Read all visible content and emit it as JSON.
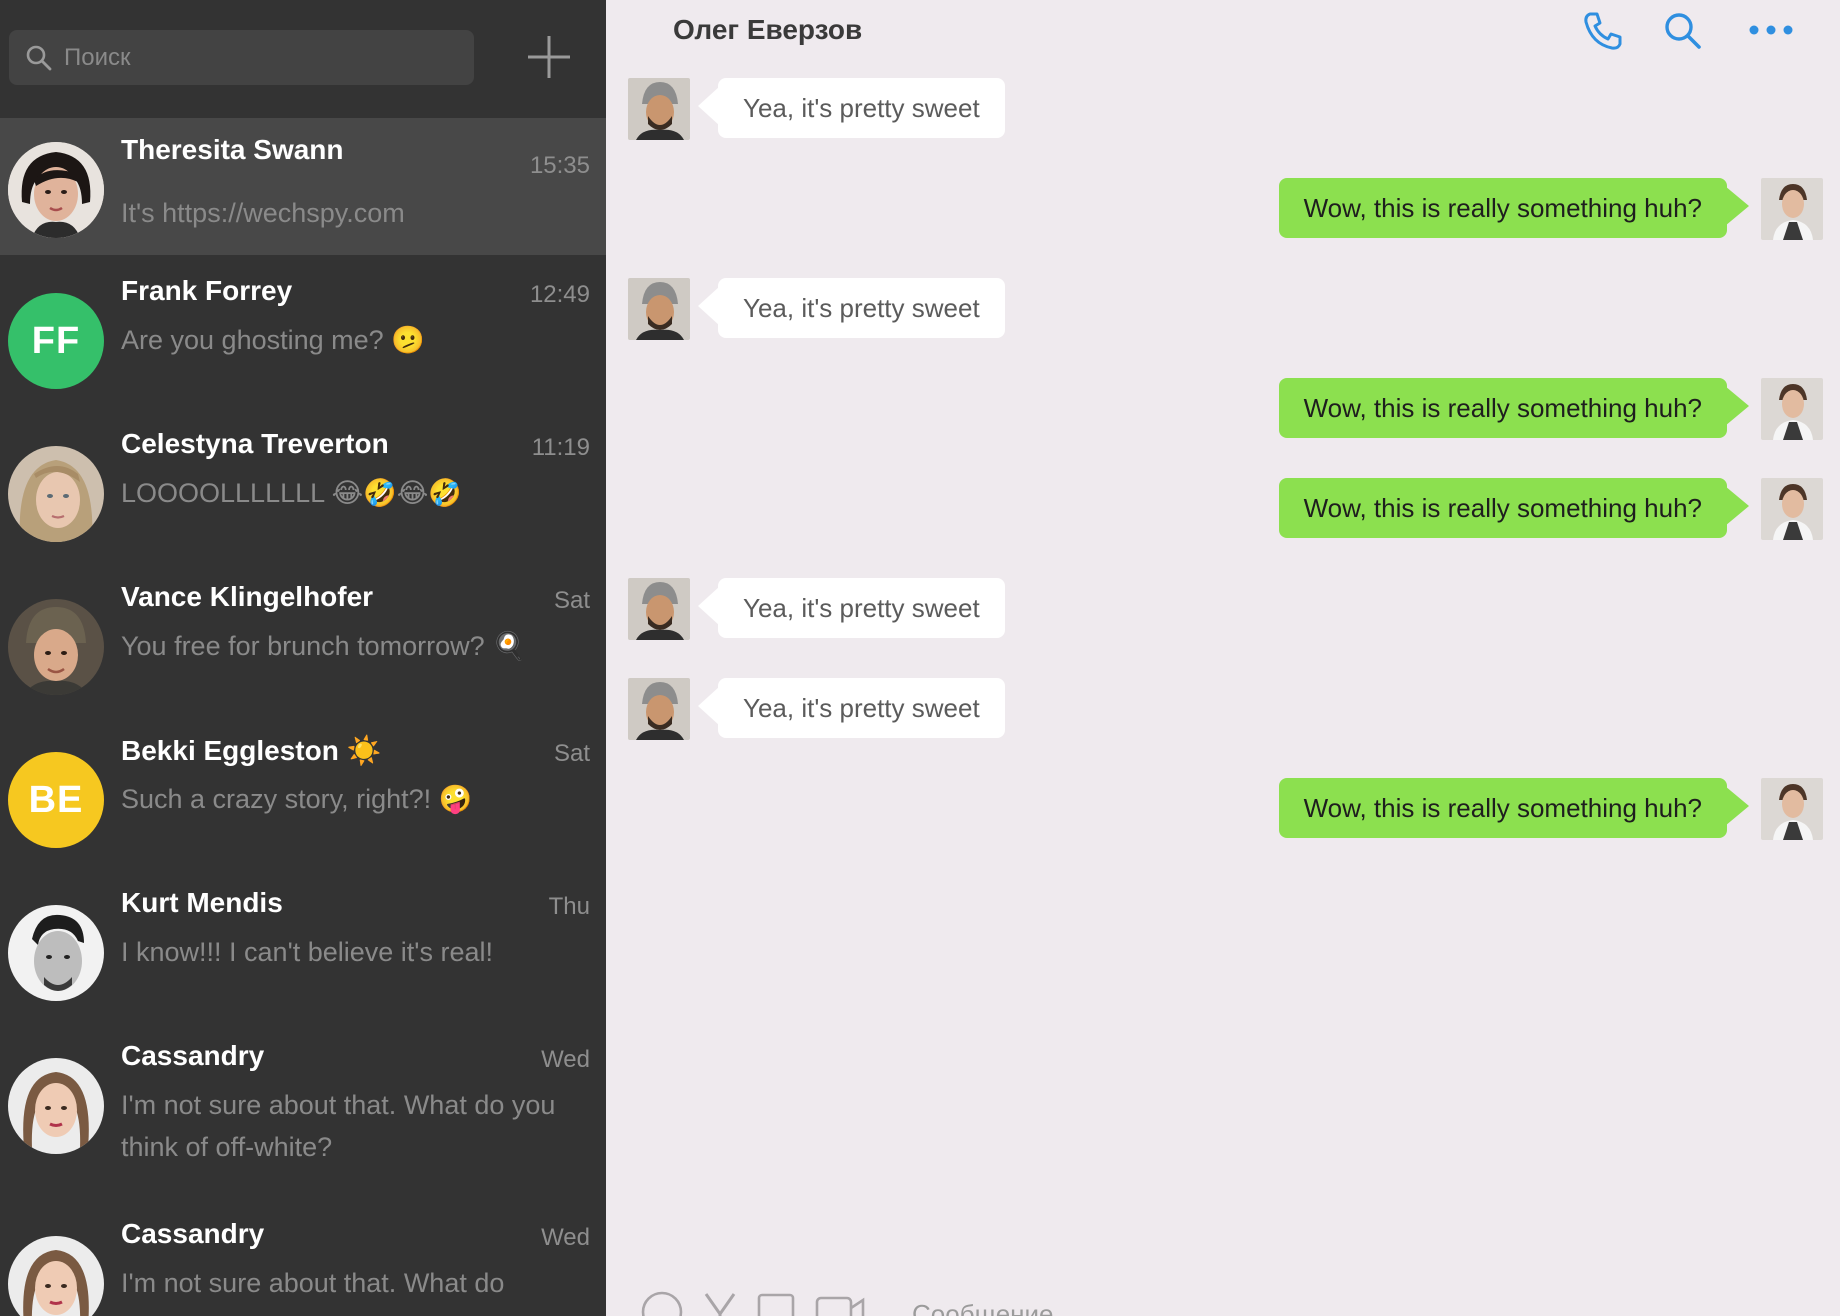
{
  "sidebar": {
    "search": {
      "placeholder": "Поиск",
      "value": ""
    },
    "new_chat_icon": "plus-icon",
    "chats": [
      {
        "name": "Theresita Swann",
        "time": "15:35",
        "preview": "It's https://wechspy.com",
        "avatar": "photo",
        "active": true
      },
      {
        "name": "Frank Forrey",
        "time": "12:49",
        "preview": "Are you ghosting me? 🫤",
        "avatar_initials": "FF",
        "avatar_color": "#35c06a"
      },
      {
        "name": "Celestyna Treverton",
        "time": "11:19",
        "preview": "LOOOOLLLLLLL 😂🤣😂🤣",
        "avatar": "photo"
      },
      {
        "name": "Vance Klingelhofer",
        "time": "Sat",
        "preview": "You free for brunch tomorrow? 🍳",
        "avatar": "photo"
      },
      {
        "name": "Bekki Eggleston ☀️",
        "time": "Sat",
        "preview": "Such a crazy story, right?! 🤪",
        "avatar_initials": "BE",
        "avatar_color": "#f6c820"
      },
      {
        "name": "Kurt Mendis",
        "time": "Thu",
        "preview": "I know!!! I can't believe it's real!",
        "avatar": "photo"
      },
      {
        "name": "Cassandry",
        "time": "Wed",
        "preview": "I'm not sure about that. What do you think of off-white?",
        "avatar": "photo"
      },
      {
        "name": "Cassandry",
        "time": "Wed",
        "preview": "I'm not sure about that. What do",
        "avatar": "photo"
      }
    ]
  },
  "chat": {
    "contact_name": "Олег Еверзов",
    "header_icons": [
      "phone-icon",
      "search-icon",
      "more-icon"
    ],
    "messages": [
      {
        "dir": "in",
        "text": "Yea, it's pretty sweet"
      },
      {
        "dir": "out",
        "text": "Wow, this is really something huh?"
      },
      {
        "dir": "in",
        "text": "Yea, it's pretty sweet"
      },
      {
        "dir": "out",
        "text": "Wow, this is really something huh?"
      },
      {
        "dir": "out",
        "text": "Wow, this is really something huh?"
      },
      {
        "dir": "in",
        "text": "Yea, it's pretty sweet"
      },
      {
        "dir": "in",
        "text": "Yea, it's pretty sweet"
      },
      {
        "dir": "out",
        "text": "Wow, this is really something huh?"
      }
    ],
    "composer": {
      "placeholder": "Сообщение",
      "value": ""
    }
  },
  "colors": {
    "sidebar_bg": "#333333",
    "pane_bg": "#efeaee",
    "outgoing_bubble": "#8ce04f",
    "incoming_bubble": "#ffffff",
    "accent": "#2f8fe0"
  }
}
